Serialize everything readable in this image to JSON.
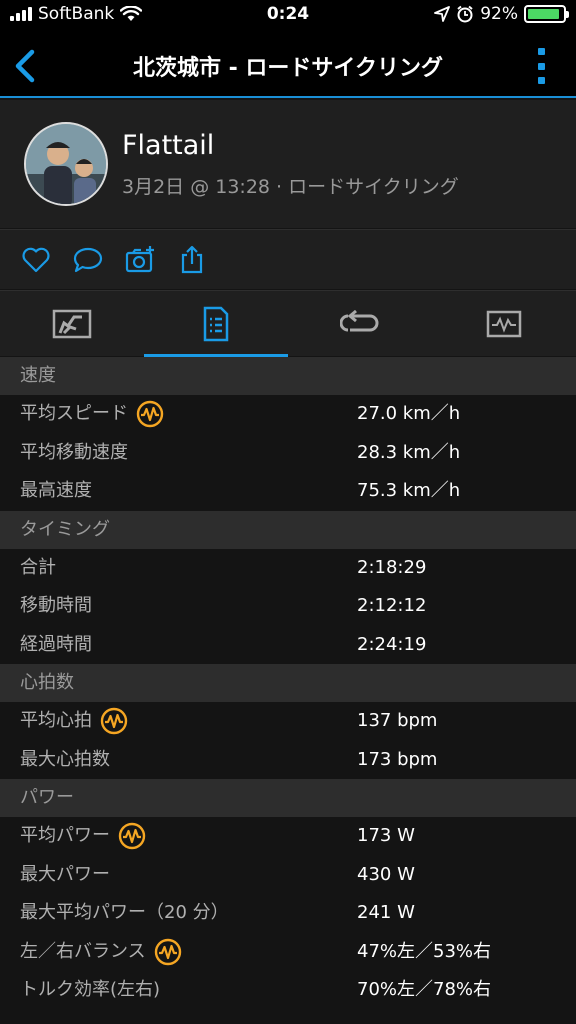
{
  "status_bar": {
    "carrier": "SoftBank",
    "time": "0:24",
    "battery": "92%",
    "battery_level": 0.92
  },
  "nav": {
    "title": "北茨城市 - ロードサイクリング"
  },
  "profile": {
    "name": "Flattail",
    "subtitle": "3月2日 @ 13:28 · ロードサイクリング"
  },
  "colors": {
    "accent": "#1a9be6",
    "badge": "#f5a623",
    "section_bg": "#2d2d2d",
    "row_bg": "#141414"
  },
  "sections": [
    {
      "title": "速度",
      "rows": [
        {
          "label": "平均スピード",
          "value": "27.0 km／h",
          "badge": true
        },
        {
          "label": "平均移動速度",
          "value": "28.3 km／h",
          "badge": false
        },
        {
          "label": "最高速度",
          "value": "75.3 km／h",
          "badge": false
        }
      ]
    },
    {
      "title": "タイミング",
      "rows": [
        {
          "label": "合計",
          "value": "2:18:29",
          "badge": false
        },
        {
          "label": "移動時間",
          "value": "2:12:12",
          "badge": false
        },
        {
          "label": "経過時間",
          "value": "2:24:19",
          "badge": false
        }
      ]
    },
    {
      "title": "心拍数",
      "rows": [
        {
          "label": "平均心拍",
          "value": "137 bpm",
          "badge": true
        },
        {
          "label": "最大心拍数",
          "value": "173 bpm",
          "badge": false
        }
      ]
    },
    {
      "title": "パワー",
      "rows": [
        {
          "label": "平均パワー",
          "value": "173 W",
          "badge": true
        },
        {
          "label": "最大パワー",
          "value": "430 W",
          "badge": false
        },
        {
          "label": "最大平均パワー（20 分）",
          "value": "241 W",
          "badge": false
        },
        {
          "label": "左／右バランス",
          "value": "47%左／53%右",
          "badge": true
        },
        {
          "label": "トルク効率(左右)",
          "value": "70%左／78%右",
          "badge": false
        }
      ]
    }
  ]
}
